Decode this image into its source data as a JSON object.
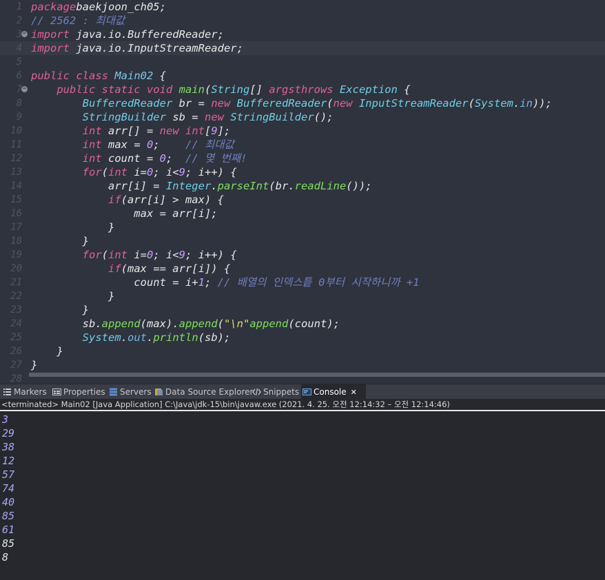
{
  "editor": {
    "lines": [
      {
        "n": "1",
        "parts": [
          [
            "kw",
            "package"
          ],
          [
            "",
            "baekjoon_ch05;"
          ]
        ]
      },
      {
        "n": "2",
        "parts": [
          [
            "cm",
            "// 2562 : 최대값"
          ]
        ]
      },
      {
        "n": "3",
        "fold": true,
        "parts": [
          [
            "kw",
            "import"
          ],
          [
            "",
            " java.io.BufferedReader;"
          ]
        ]
      },
      {
        "n": "4",
        "parts": [
          [
            "kw",
            "import"
          ],
          [
            "",
            " java.io.InputStreamReader;"
          ]
        ]
      },
      {
        "n": "5",
        "parts": []
      },
      {
        "n": "6",
        "parts": [
          [
            "kw",
            "public class "
          ],
          [
            "cl",
            "Main02"
          ],
          [
            "",
            " {"
          ]
        ]
      },
      {
        "n": "7",
        "fold": true,
        "parts": [
          [
            "",
            "    "
          ],
          [
            "kw",
            "public static void "
          ],
          [
            "fn",
            "main"
          ],
          [
            "",
            "("
          ],
          [
            "ty",
            "String"
          ],
          [
            "",
            "[] "
          ],
          [
            "kw",
            "args"
          ],
          [
            ") "
          ],
          [
            "kw",
            "throws "
          ],
          [
            "ty",
            "Exception"
          ],
          [
            "",
            " {"
          ]
        ]
      },
      {
        "n": "8",
        "parts": [
          [
            "",
            "        "
          ],
          [
            "ty",
            "BufferedReader"
          ],
          [
            "",
            " br = "
          ],
          [
            "kw",
            "new "
          ],
          [
            "ty",
            "BufferedReader"
          ],
          [
            "",
            "("
          ],
          [
            "kw",
            "new "
          ],
          [
            "ty",
            "InputStreamReader"
          ],
          [
            "",
            "("
          ],
          [
            "ty",
            "System"
          ],
          [
            "",
            "."
          ],
          [
            "fd",
            "in"
          ],
          [
            "",
            "));"
          ]
        ]
      },
      {
        "n": "9",
        "parts": [
          [
            "",
            "        "
          ],
          [
            "ty",
            "StringBuilder"
          ],
          [
            "",
            " sb = "
          ],
          [
            "kw",
            "new "
          ],
          [
            "ty",
            "StringBuilder"
          ],
          [
            "",
            "();"
          ]
        ]
      },
      {
        "n": "10",
        "parts": [
          [
            "",
            "        "
          ],
          [
            "kw",
            "int"
          ],
          [
            "",
            " arr[] = "
          ],
          [
            "kw",
            "new int"
          ],
          [
            "",
            "["
          ],
          [
            "nm",
            "9"
          ],
          [
            "",
            "];"
          ]
        ]
      },
      {
        "n": "11",
        "parts": [
          [
            "",
            "        "
          ],
          [
            "kw",
            "int"
          ],
          [
            "",
            " max = "
          ],
          [
            "nm",
            "0"
          ],
          [
            "",
            ";    "
          ],
          [
            "cm",
            "// 최대값"
          ]
        ]
      },
      {
        "n": "12",
        "parts": [
          [
            "",
            "        "
          ],
          [
            "kw",
            "int"
          ],
          [
            "",
            " count = "
          ],
          [
            "nm",
            "0"
          ],
          [
            "",
            ";  "
          ],
          [
            "cm",
            "// 몇 번째!"
          ]
        ]
      },
      {
        "n": "13",
        "parts": [
          [
            "",
            "        "
          ],
          [
            "kw",
            "for"
          ],
          [
            "",
            "("
          ],
          [
            "kw",
            "int"
          ],
          [
            "",
            " i="
          ],
          [
            "nm",
            "0"
          ],
          [
            "",
            "; i<"
          ],
          [
            "nm",
            "9"
          ],
          [
            "",
            "; i++) {"
          ]
        ]
      },
      {
        "n": "14",
        "parts": [
          [
            "",
            "            arr[i] = "
          ],
          [
            "ty",
            "Integer"
          ],
          [
            "",
            "."
          ],
          [
            "fn",
            "parseInt"
          ],
          [
            "",
            "(br."
          ],
          [
            "fn",
            "readLine"
          ],
          [
            "",
            "());"
          ]
        ]
      },
      {
        "n": "15",
        "parts": [
          [
            "",
            "            "
          ],
          [
            "kw",
            "if"
          ],
          [
            "",
            "(arr[i] > max) {"
          ]
        ]
      },
      {
        "n": "16",
        "parts": [
          [
            "",
            "                max = arr[i];"
          ]
        ]
      },
      {
        "n": "17",
        "parts": [
          [
            "",
            "            }"
          ]
        ]
      },
      {
        "n": "18",
        "parts": [
          [
            "",
            "        }"
          ]
        ]
      },
      {
        "n": "19",
        "parts": [
          [
            "",
            "        "
          ],
          [
            "kw",
            "for"
          ],
          [
            "",
            "("
          ],
          [
            "kw",
            "int"
          ],
          [
            "",
            " i="
          ],
          [
            "nm",
            "0"
          ],
          [
            "",
            "; i<"
          ],
          [
            "nm",
            "9"
          ],
          [
            "",
            "; i++) {"
          ]
        ]
      },
      {
        "n": "20",
        "parts": [
          [
            "",
            "            "
          ],
          [
            "kw",
            "if"
          ],
          [
            "",
            "(max == arr[i]) {"
          ]
        ]
      },
      {
        "n": "21",
        "parts": [
          [
            "",
            "                count = i+"
          ],
          [
            "nm",
            "1"
          ],
          [
            "",
            "; "
          ],
          [
            "cm",
            "// 배열의 인덱스틑 0부터 시작하니까 +1"
          ]
        ]
      },
      {
        "n": "22",
        "parts": [
          [
            "",
            "            }"
          ]
        ]
      },
      {
        "n": "23",
        "parts": [
          [
            "",
            "        }"
          ]
        ]
      },
      {
        "n": "24",
        "parts": [
          [
            "",
            "        sb."
          ],
          [
            "fn",
            "append"
          ],
          [
            "",
            "(max)."
          ],
          [
            "fn",
            "append"
          ],
          [
            "",
            "("
          ],
          [
            "st",
            "\"\\n\""
          ],
          [
            ")."
          ],
          [
            "fn",
            "append"
          ],
          [
            "",
            "(count);"
          ]
        ]
      },
      {
        "n": "25",
        "parts": [
          [
            "",
            "        "
          ],
          [
            "ty",
            "System"
          ],
          [
            "",
            "."
          ],
          [
            "fd",
            "out"
          ],
          [
            "",
            "."
          ],
          [
            "fn",
            "println"
          ],
          [
            "",
            "(sb);"
          ]
        ]
      },
      {
        "n": "26",
        "parts": [
          [
            "",
            "    }"
          ]
        ]
      },
      {
        "n": "27",
        "parts": [
          [
            "",
            "}"
          ]
        ]
      },
      {
        "n": "28",
        "parts": []
      }
    ]
  },
  "tabs": [
    {
      "label": "Markers",
      "icon": "markers-icon"
    },
    {
      "label": "Properties",
      "icon": "properties-icon"
    },
    {
      "label": "Servers",
      "icon": "servers-icon"
    },
    {
      "label": "Data Source Explorer",
      "icon": "data-source-icon"
    },
    {
      "label": "Snippets",
      "icon": "snippets-icon"
    },
    {
      "label": "Console",
      "icon": "console-icon",
      "active": true,
      "close": "✕"
    }
  ],
  "console": {
    "status": "<terminated> Main02 [Java Application] C:\\Java\\jdk-15\\bin\\javaw.exe  (2021. 4. 25. 오전 12:14:32 – 오전 12:14:46)",
    "input_lines": [
      "3",
      "29",
      "38",
      "12",
      "57",
      "74",
      "40",
      "85",
      "61"
    ],
    "output_lines": [
      "85",
      "8"
    ]
  },
  "colors": {
    "editor_bg": "#2f333d",
    "keyword": "#e0609a",
    "comment": "#6f7fbf",
    "type": "#6fcfe8",
    "method": "#7ee05e",
    "console_input": "#a9a7f0"
  }
}
